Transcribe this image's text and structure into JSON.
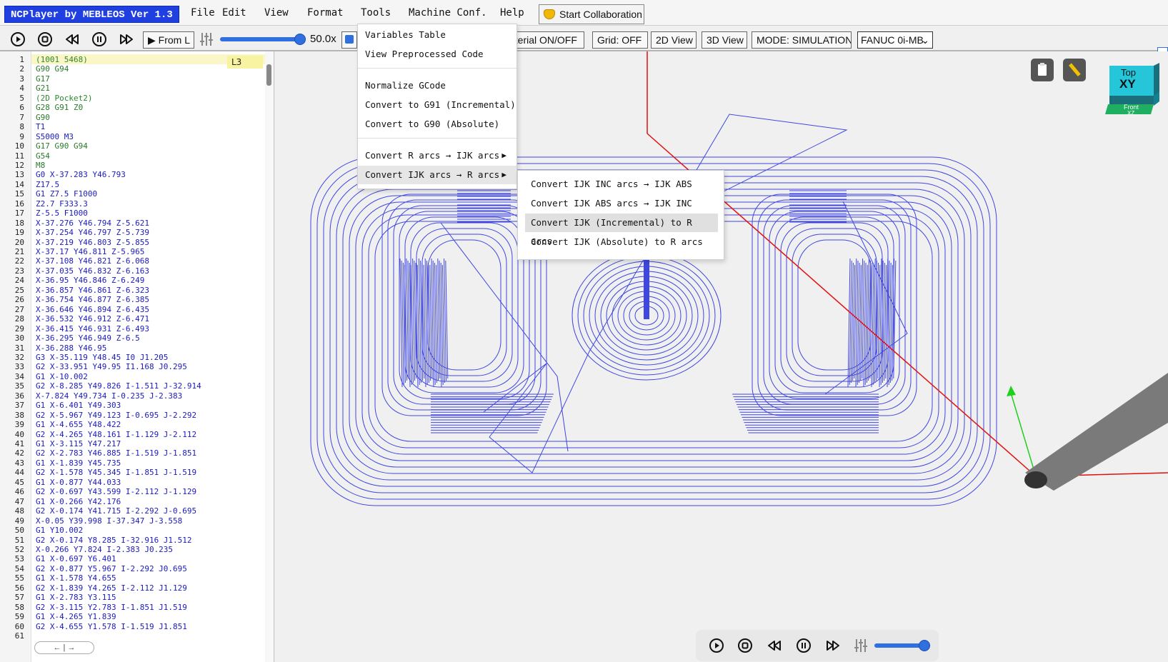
{
  "app": {
    "brand": "NCPlayer by MEBLEOS Ver 1.3",
    "menu": [
      "File",
      "Edit",
      "View",
      "Format",
      "Tools",
      "Machine Conf.",
      "Help"
    ],
    "collab_label": "Start Collaboration"
  },
  "toolbar": {
    "from_label": "▶ From L",
    "speed": "50.0x",
    "material_label": "aterial ON/OFF",
    "grid_label": "Grid: OFF",
    "view2d_label": "2D View",
    "view3d_label": "3D View",
    "mode_label": "MODE: SIMULATION",
    "controller": "FANUC 0i-MB",
    "speed_slider_fraction": 0.95
  },
  "editor": {
    "current_line_badge": "L3",
    "lines": [
      {
        "n": "1",
        "t": "(1001 5468)",
        "c": "comment"
      },
      {
        "n": "2",
        "t": "G90 G94",
        "c": "g"
      },
      {
        "n": "3",
        "t": "G17",
        "c": "g"
      },
      {
        "n": "4",
        "t": "G21",
        "c": "g"
      },
      {
        "n": "5",
        "t": "(2D Pocket2)",
        "c": "comment"
      },
      {
        "n": "6",
        "t": "G28 G91 Z0",
        "c": "g"
      },
      {
        "n": "7",
        "t": "G90",
        "c": "g"
      },
      {
        "n": "8",
        "t": "T1",
        "c": "b"
      },
      {
        "n": "9",
        "t": "S5000 M3",
        "c": "m"
      },
      {
        "n": "10",
        "t": "G17 G90 G94",
        "c": "g"
      },
      {
        "n": "11",
        "t": "G54",
        "c": "g"
      },
      {
        "n": "12",
        "t": "M8",
        "c": "g"
      },
      {
        "n": "13",
        "t": "G0 X-37.283 Y46.793",
        "c": "m"
      },
      {
        "n": "14",
        "t": "Z17.5",
        "c": "b"
      },
      {
        "n": "15",
        "t": "G1 Z7.5 F1000",
        "c": "m"
      },
      {
        "n": "16",
        "t": "Z2.7 F333.3",
        "c": "b"
      },
      {
        "n": "17",
        "t": "Z-5.5 F1000",
        "c": "b"
      },
      {
        "n": "18",
        "t": "X-37.276 Y46.794 Z-5.621",
        "c": "b"
      },
      {
        "n": "19",
        "t": "X-37.254 Y46.797 Z-5.739",
        "c": "b"
      },
      {
        "n": "20",
        "t": "X-37.219 Y46.803 Z-5.855",
        "c": "b"
      },
      {
        "n": "21",
        "t": "X-37.17 Y46.811 Z-5.965",
        "c": "b"
      },
      {
        "n": "22",
        "t": "X-37.108 Y46.821 Z-6.068",
        "c": "b"
      },
      {
        "n": "23",
        "t": "X-37.035 Y46.832 Z-6.163",
        "c": "b"
      },
      {
        "n": "24",
        "t": "X-36.95 Y46.846 Z-6.249",
        "c": "b"
      },
      {
        "n": "25",
        "t": "X-36.857 Y46.861 Z-6.323",
        "c": "b"
      },
      {
        "n": "26",
        "t": "X-36.754 Y46.877 Z-6.385",
        "c": "b"
      },
      {
        "n": "27",
        "t": "X-36.646 Y46.894 Z-6.435",
        "c": "b"
      },
      {
        "n": "28",
        "t": "X-36.532 Y46.912 Z-6.471",
        "c": "b"
      },
      {
        "n": "29",
        "t": "X-36.415 Y46.931 Z-6.493",
        "c": "b"
      },
      {
        "n": "30",
        "t": "X-36.295 Y46.949 Z-6.5",
        "c": "b"
      },
      {
        "n": "31",
        "t": "X-36.288 Y46.95",
        "c": "b"
      },
      {
        "n": "32",
        "t": "G3 X-35.119 Y48.45 I0 J1.205",
        "c": "m"
      },
      {
        "n": "33",
        "t": "G2 X-33.951 Y49.95 I1.168 J0.295",
        "c": "m"
      },
      {
        "n": "34",
        "t": "G1 X-10.002",
        "c": "m"
      },
      {
        "n": "35",
        "t": "G2 X-8.285 Y49.826 I-1.511 J-32.914",
        "c": "m"
      },
      {
        "n": "36",
        "t": "X-7.824 Y49.734 I-0.235 J-2.383",
        "c": "b"
      },
      {
        "n": "37",
        "t": "G1 X-6.401 Y49.303",
        "c": "m"
      },
      {
        "n": "38",
        "t": "G2 X-5.967 Y49.123 I-0.695 J-2.292",
        "c": "m"
      },
      {
        "n": "39",
        "t": "G1 X-4.655 Y48.422",
        "c": "m"
      },
      {
        "n": "40",
        "t": "G2 X-4.265 Y48.161 I-1.129 J-2.112",
        "c": "m"
      },
      {
        "n": "41",
        "t": "G1 X-3.115 Y47.217",
        "c": "m"
      },
      {
        "n": "42",
        "t": "G2 X-2.783 Y46.885 I-1.519 J-1.851",
        "c": "m"
      },
      {
        "n": "43",
        "t": "G1 X-1.839 Y45.735",
        "c": "m"
      },
      {
        "n": "44",
        "t": "G2 X-1.578 Y45.345 I-1.851 J-1.519",
        "c": "m"
      },
      {
        "n": "45",
        "t": "G1 X-0.877 Y44.033",
        "c": "m"
      },
      {
        "n": "46",
        "t": "G2 X-0.697 Y43.599 I-2.112 J-1.129",
        "c": "m"
      },
      {
        "n": "47",
        "t": "G1 X-0.266 Y42.176",
        "c": "m"
      },
      {
        "n": "48",
        "t": "G2 X-0.174 Y41.715 I-2.292 J-0.695",
        "c": "m"
      },
      {
        "n": "49",
        "t": "X-0.05 Y39.998 I-37.347 J-3.558",
        "c": "b"
      },
      {
        "n": "50",
        "t": "G1 Y10.002",
        "c": "m"
      },
      {
        "n": "51",
        "t": "G2 X-0.174 Y8.285 I-32.916 J1.512",
        "c": "m"
      },
      {
        "n": "52",
        "t": "X-0.266 Y7.824 I-2.383 J0.235",
        "c": "b"
      },
      {
        "n": "53",
        "t": "G1 X-0.697 Y6.401",
        "c": "m"
      },
      {
        "n": "54",
        "t": "G2 X-0.877 Y5.967 I-2.292 J0.695",
        "c": "m"
      },
      {
        "n": "55",
        "t": "G1 X-1.578 Y4.655",
        "c": "m"
      },
      {
        "n": "56",
        "t": "G2 X-1.839 Y4.265 I-2.112 J1.129",
        "c": "m"
      },
      {
        "n": "57",
        "t": "G1 X-2.783 Y3.115",
        "c": "m"
      },
      {
        "n": "58",
        "t": "G2 X-3.115 Y2.783 I-1.851 J1.519",
        "c": "m"
      },
      {
        "n": "59",
        "t": "G1 X-4.265 Y1.839",
        "c": "m"
      },
      {
        "n": "60",
        "t": "G2 X-4.655 Y1.578 I-1.519 J1.851",
        "c": "m"
      },
      {
        "n": "61",
        "t": "",
        "c": "b"
      }
    ]
  },
  "tools_menu": {
    "items": [
      {
        "label": "Variables Table",
        "arrow": ""
      },
      {
        "label": "View Preprocessed Code",
        "arrow": ""
      },
      {
        "label": "Normalize GCode",
        "arrow": ""
      },
      {
        "label": "Convert to G91 (Incremental)",
        "arrow": ""
      },
      {
        "label": "Convert to G90 (Absolute)",
        "arrow": ""
      },
      {
        "label": "Convert R arcs → IJK arcs",
        "arrow": "▶"
      },
      {
        "label": "Convert IJK arcs → R arcs",
        "arrow": "▶"
      }
    ],
    "submenu": [
      "Convert IJK INC arcs → IJK ABS",
      "Convert IJK ABS arcs → IJK INC",
      "Convert IJK (Incremental) to R arcs",
      "Convert IJK (Absolute) to R arcs"
    ]
  },
  "viewcube": {
    "top_label": "Top",
    "top_axis": "XY",
    "front_label": "Front",
    "front_axis": "XZ"
  },
  "colors": {
    "toolpath": "#3f47e0",
    "x_axis": "#e01010",
    "y_axis": "#1fd01f",
    "z_axis": "#1f3fe0",
    "brand": "#1f3fe0",
    "cube": "#26c6da"
  },
  "bottom_slider_fraction": 0.9
}
